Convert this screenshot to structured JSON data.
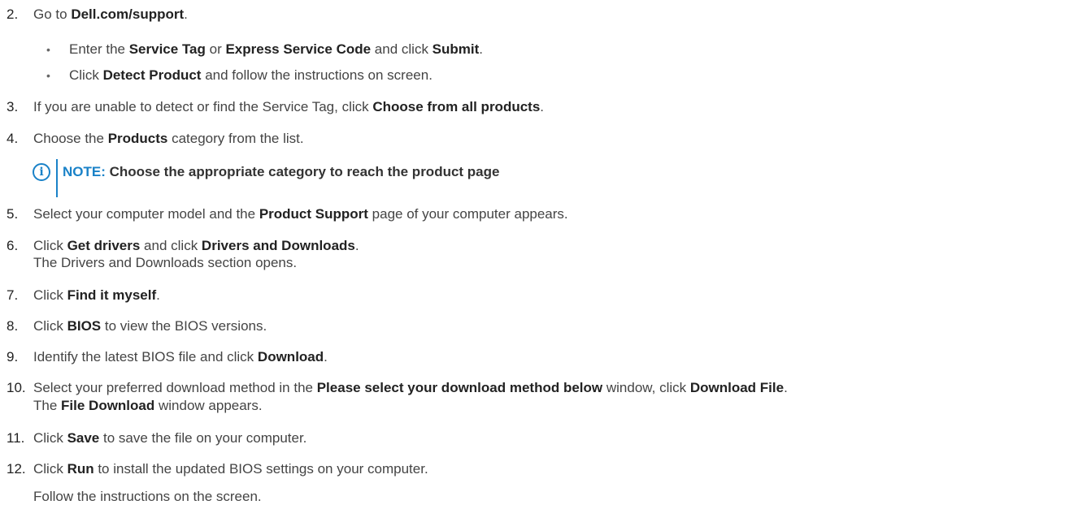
{
  "steps": [
    {
      "num": "2.",
      "segments": [
        {
          "t": "Go to "
        },
        {
          "t": "Dell.com/support",
          "b": true
        },
        {
          "t": "."
        }
      ]
    },
    {
      "bullet": true,
      "segments": [
        {
          "t": "Enter the "
        },
        {
          "t": "Service Tag",
          "b": true
        },
        {
          "t": " or "
        },
        {
          "t": "Express Service Code",
          "b": true
        },
        {
          "t": " and click "
        },
        {
          "t": "Submit",
          "b": true
        },
        {
          "t": "."
        }
      ]
    },
    {
      "bullet": true,
      "segments": [
        {
          "t": "Click "
        },
        {
          "t": "Detect Product",
          "b": true
        },
        {
          "t": " and follow the instructions on screen."
        }
      ]
    },
    {
      "num": "3.",
      "segments": [
        {
          "t": "If you are unable to detect or find the Service Tag, click "
        },
        {
          "t": "Choose from all products",
          "b": true
        },
        {
          "t": "."
        }
      ]
    },
    {
      "num": "4.",
      "segments": [
        {
          "t": "Choose the "
        },
        {
          "t": "Products",
          "b": true
        },
        {
          "t": " category from the list."
        }
      ]
    },
    {
      "num": "5.",
      "segments": [
        {
          "t": "Select your computer model and the "
        },
        {
          "t": "Product Support",
          "b": true
        },
        {
          "t": " page of your computer appears."
        }
      ]
    },
    {
      "num": "6.",
      "segments": [
        {
          "t": "Click "
        },
        {
          "t": "Get drivers",
          "b": true
        },
        {
          "t": " and click "
        },
        {
          "t": "Drivers and Downloads",
          "b": true
        },
        {
          "t": "."
        }
      ]
    },
    {
      "cont": true,
      "segments": [
        {
          "t": "The Drivers and Downloads section opens."
        }
      ]
    },
    {
      "num": "7.",
      "segments": [
        {
          "t": "Click "
        },
        {
          "t": "Find it myself",
          "b": true
        },
        {
          "t": "."
        }
      ]
    },
    {
      "num": "8.",
      "segments": [
        {
          "t": "Click "
        },
        {
          "t": "BIOS",
          "b": true
        },
        {
          "t": " to view the BIOS versions."
        }
      ]
    },
    {
      "num": "9.",
      "segments": [
        {
          "t": "Identify the latest BIOS file and click "
        },
        {
          "t": "Download",
          "b": true
        },
        {
          "t": "."
        }
      ]
    },
    {
      "num": "10.",
      "segments": [
        {
          "t": "Select your preferred download method in the "
        },
        {
          "t": "Please select your download method below",
          "b": true
        },
        {
          "t": " window, click "
        },
        {
          "t": "Download File",
          "b": true
        },
        {
          "t": "."
        }
      ]
    },
    {
      "cont": true,
      "segments": [
        {
          "t": "The "
        },
        {
          "t": "File Download",
          "b": true
        },
        {
          "t": " window appears."
        }
      ]
    },
    {
      "num": "11.",
      "segments": [
        {
          "t": "Click "
        },
        {
          "t": "Save",
          "b": true
        },
        {
          "t": " to save the file on your computer."
        }
      ]
    },
    {
      "num": "12.",
      "segments": [
        {
          "t": "Click "
        },
        {
          "t": "Run",
          "b": true
        },
        {
          "t": " to install the updated BIOS settings on your computer."
        }
      ]
    },
    {
      "cont": true,
      "segments": [
        {
          "t": "Follow the instructions on the screen."
        }
      ]
    }
  ],
  "note": {
    "icon": "info-circle-icon",
    "glyph": "i",
    "label": "NOTE:",
    "text": " Choose the appropriate category to reach the product page"
  },
  "colors": {
    "accent": "#1a82c8",
    "text": "#444444",
    "bold": "#222222"
  }
}
